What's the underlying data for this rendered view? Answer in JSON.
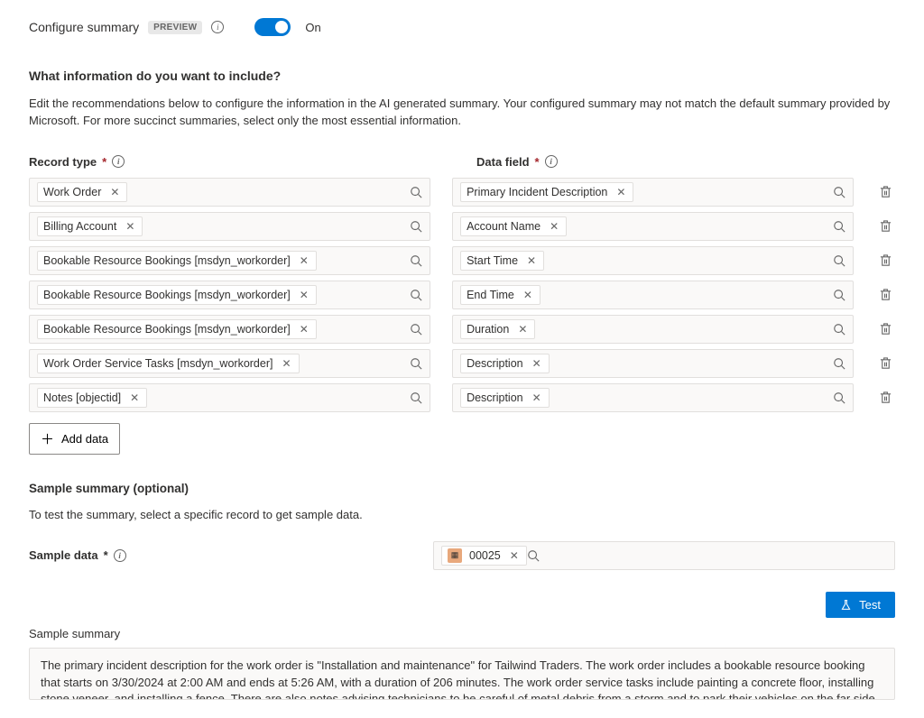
{
  "header": {
    "title": "Configure summary",
    "badge": "PREVIEW",
    "toggle_state": "On"
  },
  "question": {
    "title": "What information do you want to include?",
    "help": "Edit the recommendations below to configure the information in the AI generated summary. Your configured summary may not match the default summary provided by Microsoft. For more succinct summaries, select only the most essential information."
  },
  "columns": {
    "record_type_label": "Record type",
    "data_field_label": "Data field"
  },
  "rows": [
    {
      "record_type": "Work Order",
      "data_field": "Primary Incident Description"
    },
    {
      "record_type": "Billing Account",
      "data_field": "Account Name"
    },
    {
      "record_type": "Bookable Resource Bookings [msdyn_workorder]",
      "data_field": "Start Time"
    },
    {
      "record_type": "Bookable Resource Bookings [msdyn_workorder]",
      "data_field": "End Time"
    },
    {
      "record_type": "Bookable Resource Bookings [msdyn_workorder]",
      "data_field": "Duration"
    },
    {
      "record_type": "Work Order Service Tasks [msdyn_workorder]",
      "data_field": "Description"
    },
    {
      "record_type": "Notes [objectid]",
      "data_field": "Description"
    }
  ],
  "add_button": "Add data",
  "sample": {
    "title": "Sample summary (optional)",
    "help": "To test the summary, select a specific record to get sample data.",
    "label": "Sample data",
    "value": "00025"
  },
  "test_button": "Test",
  "output": {
    "label": "Sample summary",
    "text": "The primary incident description for the work order is \"Installation and maintenance\" for Tailwind Traders. The work order includes a bookable resource booking that starts on 3/30/2024 at 2:00 AM and ends at 5:26 AM, with a duration of 206 minutes. The work order service tasks include painting a concrete floor, installing stone veneer, and installing a fence. There are also notes advising technicians to be careful of metal debris from a storm and to park their vehicles on the far side of the property to avoid gas generators"
  }
}
